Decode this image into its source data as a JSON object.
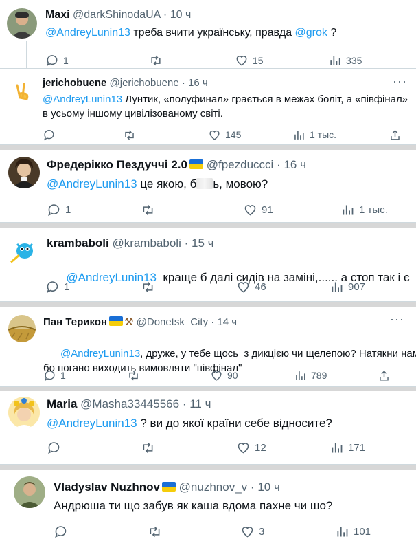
{
  "tweets": [
    {
      "name": "Maxi",
      "handle": "@darkShinodaUA",
      "dot": "·",
      "time": "10 ч",
      "segments": [
        "@AndreyLunin13",
        " треба вчити українську, правда ",
        "@grok",
        " ?"
      ],
      "replies": "1",
      "retweets": "",
      "likes": "15",
      "views": "335"
    },
    {
      "name": "jerichobuene",
      "handle": "@jerichobuene",
      "dot": "·",
      "time": "16 ч",
      "segments": [
        "@AndreyLunin13",
        " Лунтик, «полуфинал» грається в межах боліт, а «півфінал»",
        "в усьому іншому цивілізованому світі."
      ],
      "replies": "",
      "retweets": "",
      "likes": "145",
      "views": "1 тыс."
    },
    {
      "name": "Фредерікко Пездуччі 2.0",
      "handle": "@fpezduccci",
      "dot": "·",
      "time": "16 ч",
      "segments": [
        "@AndreyLunin13",
        " це якою, б",
        "ь, мовою?"
      ],
      "replies": "1",
      "retweets": "",
      "likes": "91",
      "views": "1 тыс."
    },
    {
      "name": "krambaboli",
      "handle": "@krambaboli",
      "dot": "·",
      "time": "15 ч",
      "segments": [
        "@AndreyLunin13",
        "  краще б далі сидів на заміні,...... а стоп так і є"
      ],
      "replies": "1",
      "retweets": "",
      "likes": "46",
      "views": "907"
    },
    {
      "name": "Пан Терикон",
      "handle": "@Donetsk_City",
      "dot": "·",
      "time": "14 ч",
      "emoji": "⚒",
      "segments": [
        "@AndreyLunin13",
        ", друже, у тебе щось  з дикцією чи щелепою? Натякни нам,",
        "бо погано виходить вимовляти \"півфінал\""
      ],
      "replies": "1",
      "retweets": "",
      "likes": "90",
      "views": "789"
    },
    {
      "name": "Maria",
      "handle": "@Masha33445566",
      "dot": "·",
      "time": "11 ч",
      "segments": [
        "@AndreyLunin13",
        " ? ви до якої країни себе відносите?"
      ],
      "replies": "",
      "retweets": "",
      "likes": "12",
      "views": "171"
    },
    {
      "name": "Vladyslav Nuzhnov",
      "handle": "@nuzhnov_v",
      "dot": "·",
      "time": "10 ч",
      "segments": [
        "Андрюша ти що забув як каша вдома пахне чи шо?"
      ],
      "replies": "",
      "retweets": "",
      "likes": "3",
      "views": "101"
    }
  ],
  "icons": {
    "reply": "reply-icon",
    "retweet": "retweet-icon",
    "like": "like-icon",
    "views": "views-icon",
    "share": "share-icon",
    "more": "more-icon"
  },
  "more_glyph": "···",
  "colors": {
    "accent": "#1d9bf0",
    "muted": "#536471",
    "text": "#0f1419",
    "separator": "#d7d7d7"
  }
}
